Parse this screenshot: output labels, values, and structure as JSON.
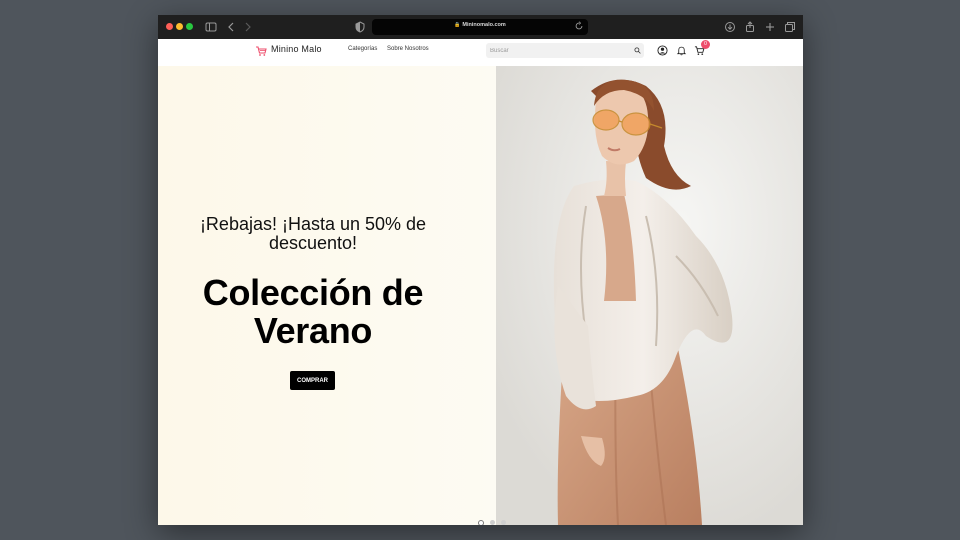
{
  "browser": {
    "url": "Mininomalo.com",
    "icons": [
      "sidebar-icon",
      "back-icon",
      "forward-icon",
      "shield-icon",
      "download-icon",
      "share-icon",
      "new-tab-icon",
      "tabs-overview-icon"
    ]
  },
  "header": {
    "brand": "Minino Malo",
    "nav": [
      "Categorías",
      "Sobre Nosotros"
    ],
    "search_placeholder": "Buscar",
    "cart_count": "0",
    "accent_color": "#ee4d6b"
  },
  "hero": {
    "promo_text": "¡Rebajas! ¡Hasta un 50% de descuento!",
    "title": "Colección de Verano",
    "cta_label": "COMPRAR",
    "carousel_active_index": 0,
    "carousel_count": 3
  }
}
